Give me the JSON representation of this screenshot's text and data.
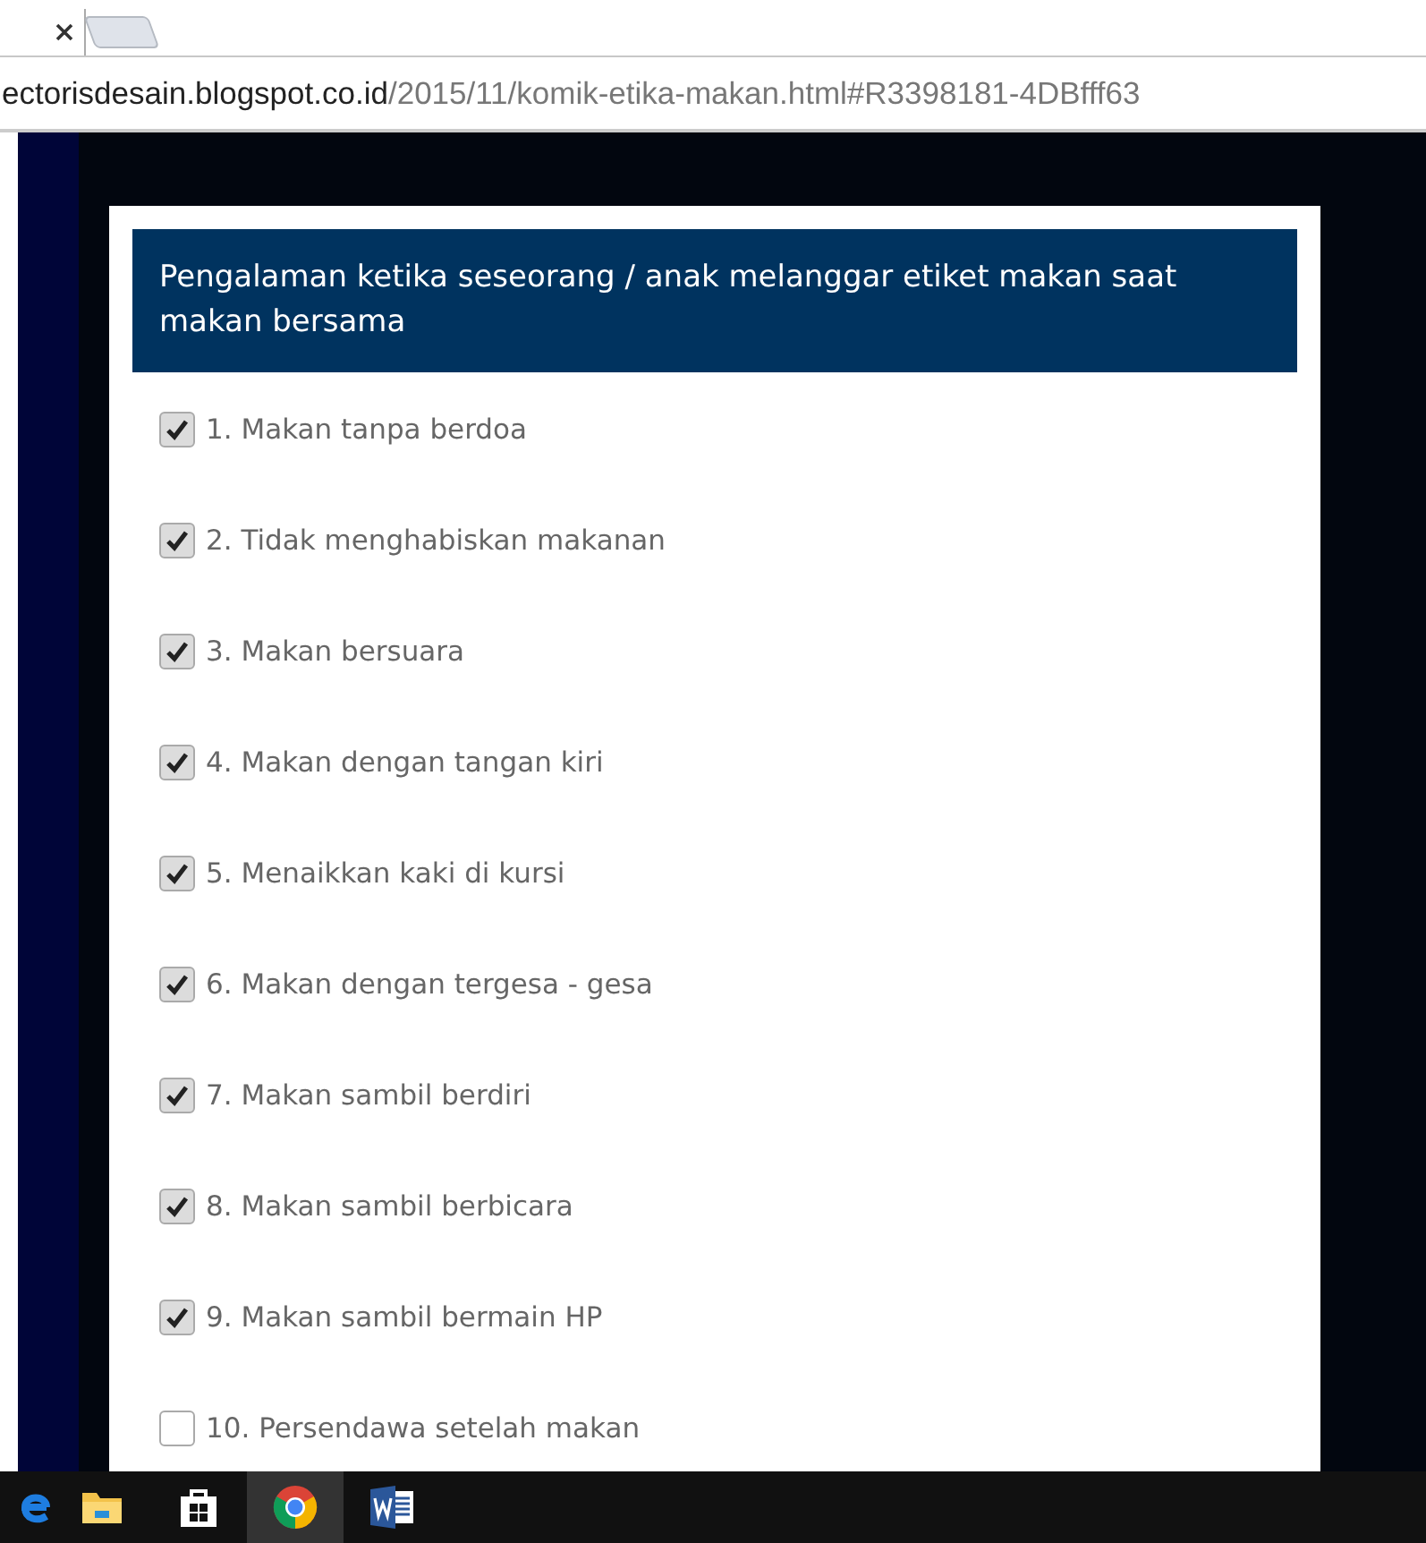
{
  "browser": {
    "url_host": "ectorisdesain.blogspot.co.id",
    "url_path": "/2015/11/komik-etika-makan.html#R3398181-4DBfff63"
  },
  "card": {
    "title": "Pengalaman ketika seseorang / anak melanggar etiket makan saat makan bersama",
    "items": [
      {
        "label": "1. Makan tanpa berdoa",
        "checked": true
      },
      {
        "label": "2. Tidak menghabiskan makanan",
        "checked": true
      },
      {
        "label": "3. Makan bersuara",
        "checked": true
      },
      {
        "label": "4. Makan dengan tangan kiri",
        "checked": true
      },
      {
        "label": "5. Menaikkan kaki di kursi",
        "checked": true
      },
      {
        "label": "6. Makan dengan tergesa - gesa",
        "checked": true
      },
      {
        "label": "7. Makan sambil berdiri",
        "checked": true
      },
      {
        "label": "8. Makan sambil berbicara",
        "checked": true
      },
      {
        "label": "9. Makan sambil bermain HP",
        "checked": true
      },
      {
        "label": "10. Persendawa setelah makan",
        "checked": false
      }
    ]
  },
  "taskbar": {
    "apps": [
      {
        "kind": "edge",
        "selected": false
      },
      {
        "kind": "folder",
        "selected": false
      },
      {
        "kind": "store",
        "selected": false
      },
      {
        "kind": "chrome",
        "selected": true
      },
      {
        "kind": "word",
        "selected": false
      }
    ]
  }
}
